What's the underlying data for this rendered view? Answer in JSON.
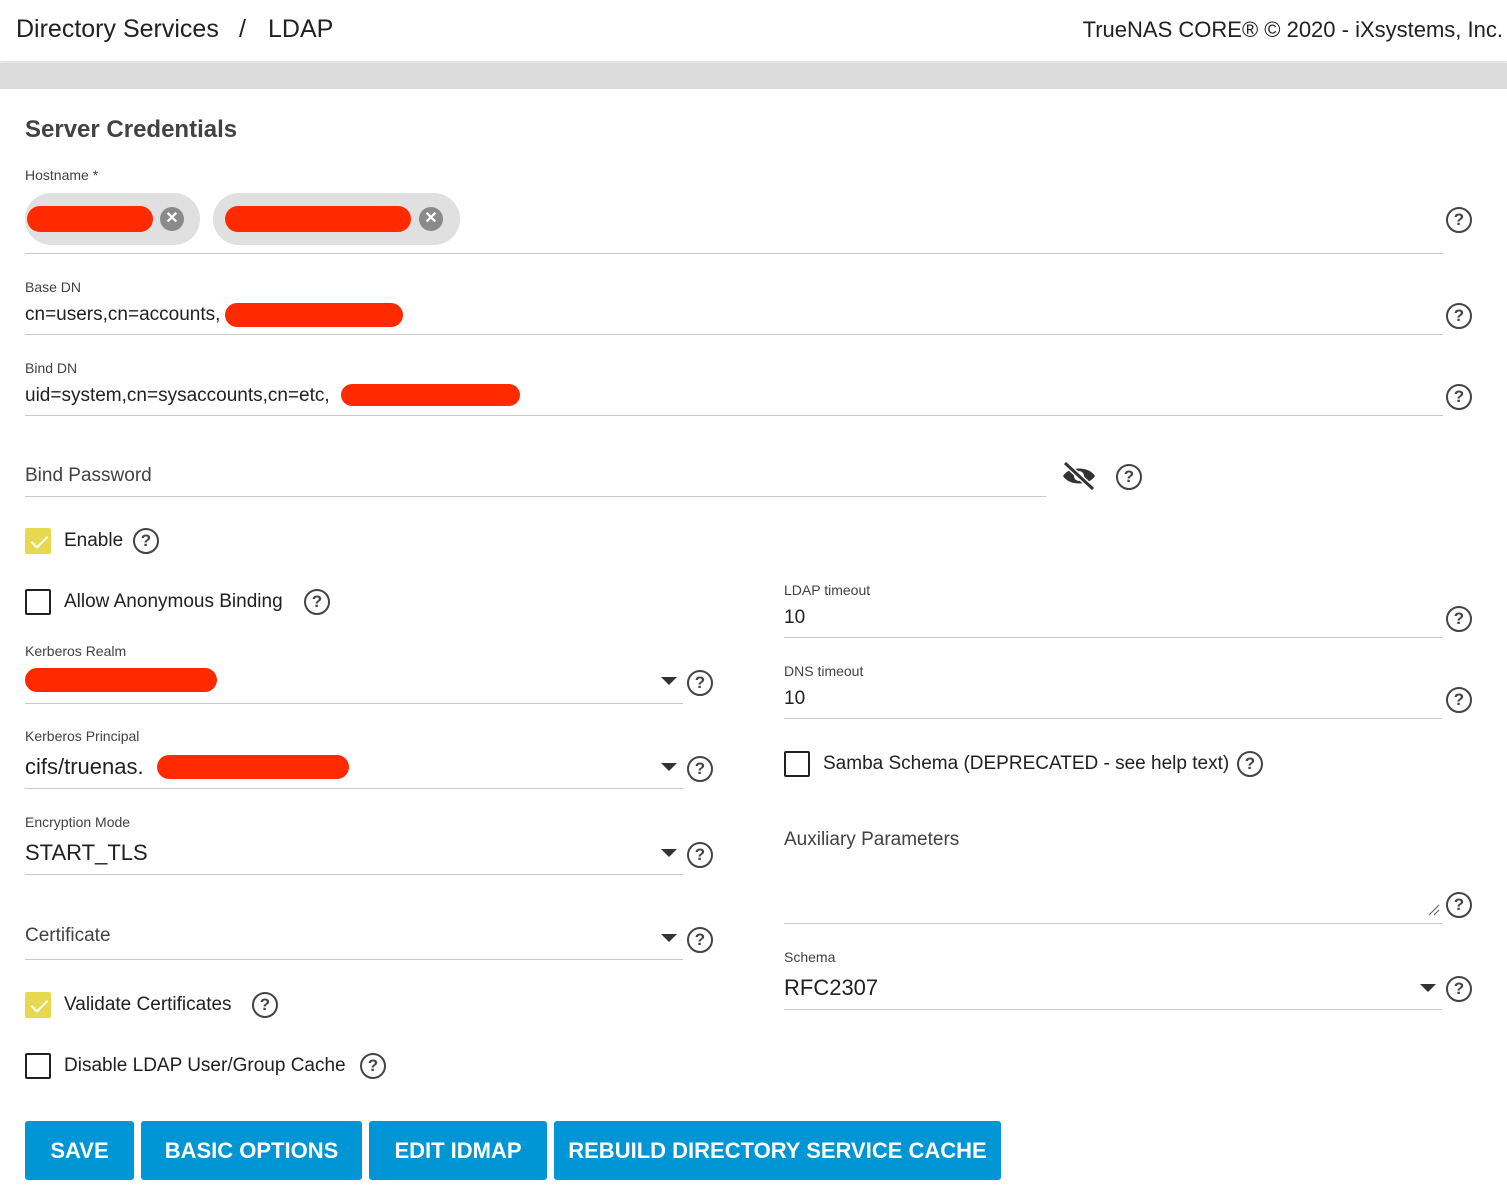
{
  "breadcrumb": {
    "parent": "Directory Services",
    "separator": "/",
    "current": "LDAP"
  },
  "copyright": "TrueNAS CORE® © 2020 - iXsystems, Inc.",
  "section_title": "Server Credentials",
  "fields": {
    "hostname": {
      "label": "Hostname *",
      "chips": [
        "[redacted]",
        "[redacted]"
      ]
    },
    "base_dn": {
      "label": "Base DN",
      "value": "cn=users,cn=accounts,"
    },
    "bind_dn": {
      "label": "Bind DN",
      "value": "uid=system,cn=sysaccounts,cn=etc,"
    },
    "bind_password": {
      "placeholder": "Bind Password"
    },
    "enable": {
      "label": "Enable",
      "checked": true
    },
    "allow_anonymous": {
      "label": "Allow Anonymous Binding",
      "checked": false
    },
    "kerberos_realm": {
      "label": "Kerberos Realm",
      "value": "[redacted]"
    },
    "kerberos_principal": {
      "label": "Kerberos Principal",
      "value": "cifs/truenas."
    },
    "encryption_mode": {
      "label": "Encryption Mode",
      "value": "START_TLS"
    },
    "certificate": {
      "placeholder": "Certificate"
    },
    "validate_certificates": {
      "label": "Validate Certificates",
      "checked": true
    },
    "disable_cache": {
      "label": "Disable LDAP User/Group Cache",
      "checked": false
    },
    "ldap_timeout": {
      "label": "LDAP timeout",
      "value": "10"
    },
    "dns_timeout": {
      "label": "DNS timeout",
      "value": "10"
    },
    "samba_schema": {
      "label": "Samba Schema (DEPRECATED - see help text)",
      "checked": false
    },
    "auxiliary_parameters": {
      "placeholder": "Auxiliary Parameters"
    },
    "schema": {
      "label": "Schema",
      "value": "RFC2307"
    }
  },
  "help_glyph": "?",
  "chip_remove_glyph": "✕",
  "buttons": {
    "save": "SAVE",
    "basic_options": "BASIC OPTIONS",
    "edit_idmap": "EDIT IDMAP",
    "rebuild_cache": "REBUILD DIRECTORY SERVICE CACHE"
  },
  "colors": {
    "primary_button": "#0095d5",
    "checkbox_checked": "#e6d94f",
    "redaction": "#ff2a00"
  },
  "icons": [
    "help-icon",
    "visibility-off-icon",
    "chip-remove-icon",
    "dropdown-caret-icon",
    "resize-handle-icon"
  ]
}
